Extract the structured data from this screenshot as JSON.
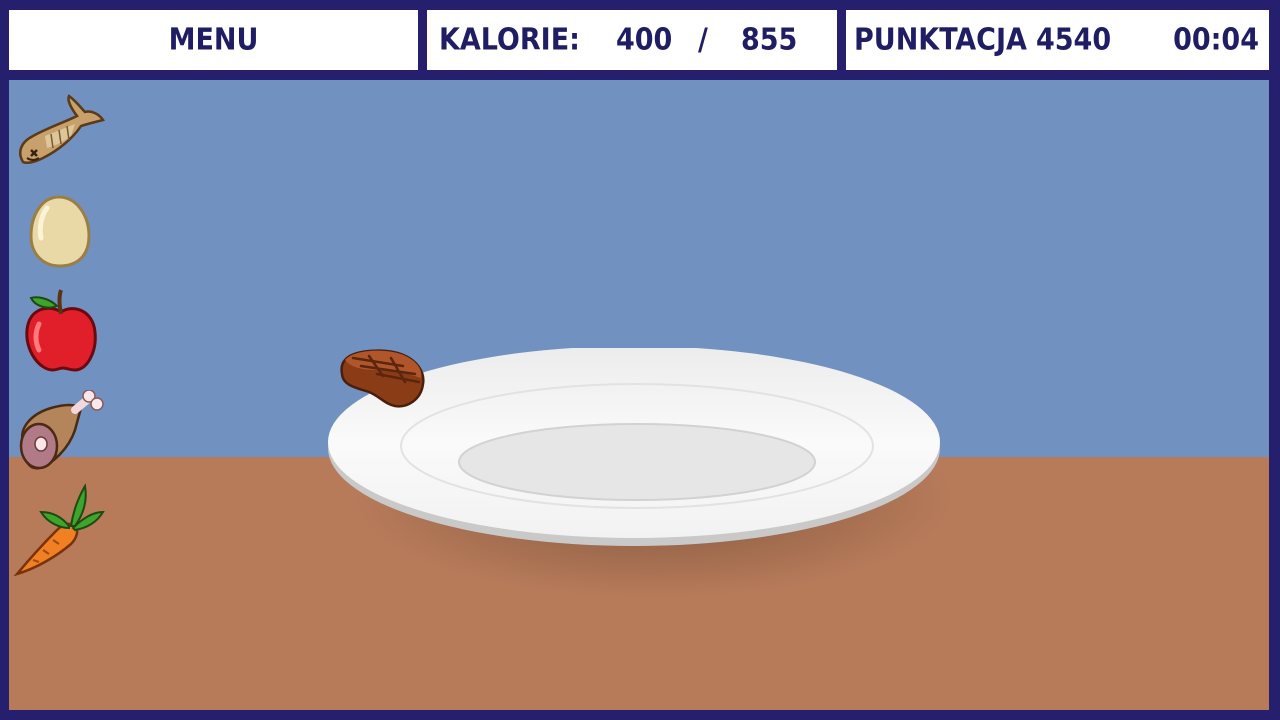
{
  "hud": {
    "menu_label": "MENU",
    "calories_label": "KALORIE:",
    "calories_current": "400",
    "calories_separator": "/",
    "calories_target": "855",
    "score_label": "PUNKTACJA",
    "score_value": "4540",
    "timer": "00:04"
  },
  "colors": {
    "frame": "#251f6e",
    "text": "#1f1d63",
    "wall": "#7192c0",
    "table": "#b77b5a",
    "plate": "#f4f4f4"
  },
  "food_items": [
    {
      "name": "fish-icon"
    },
    {
      "name": "potato-icon"
    },
    {
      "name": "apple-icon"
    },
    {
      "name": "ham-leg-icon"
    },
    {
      "name": "carrot-icon"
    }
  ],
  "plate_items": [
    {
      "name": "steak-icon"
    }
  ]
}
